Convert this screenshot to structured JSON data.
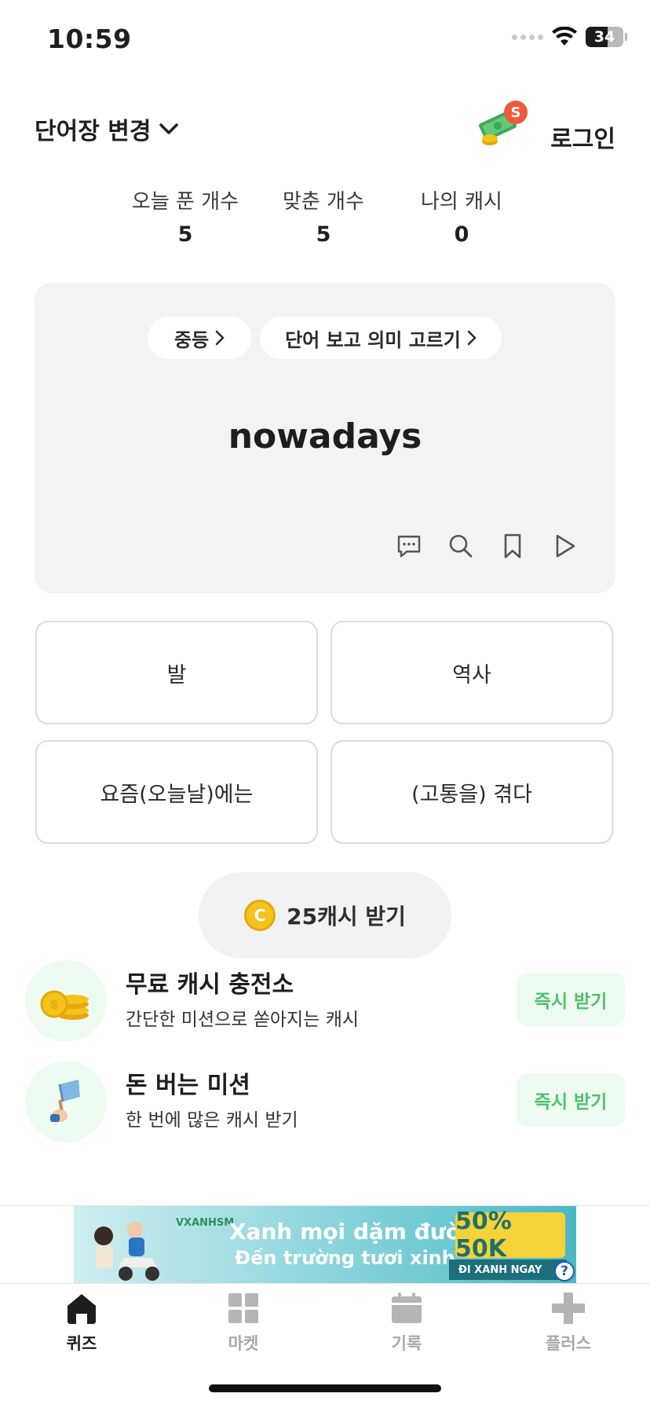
{
  "status_bar": {
    "time": "10:59",
    "battery": "34"
  },
  "header": {
    "wordbook_label": "단어장 변경",
    "login_label": "로그인",
    "badge": "S"
  },
  "stats": [
    {
      "label": "오늘 푼 개수",
      "value": "5"
    },
    {
      "label": "맞춘 개수",
      "value": "5"
    },
    {
      "label": "나의 캐시",
      "value": "0"
    }
  ],
  "quiz": {
    "level_chip": "중등",
    "mode_chip": "단어 보고 의미 고르기",
    "word": "nowadays",
    "icons": [
      "comment-icon",
      "search-icon",
      "bookmark-icon",
      "play-icon"
    ]
  },
  "answers": [
    "발",
    "역사",
    "요즘(오늘날)에는",
    "(고통을) 겪다"
  ],
  "cash_button": {
    "coin": "C",
    "label": "25캐시 받기"
  },
  "promos": [
    {
      "title": "무료 캐시 충전소",
      "subtitle": "간단한 미션으로 쏟아지는 캐시",
      "button": "즉시 받기",
      "icon": "coins-icon"
    },
    {
      "title": "돈 버는 미션",
      "subtitle": "한 번에 많은 캐시 받기",
      "button": "즉시 받기",
      "icon": "flag-hand-icon"
    }
  ],
  "ad": {
    "brand": "VXANHSM",
    "line1": "Xanh mọi dặm đường",
    "line2": "Đến trường tươi xinh",
    "offer": "50% 50K",
    "cta": "ĐI XANH NGAY",
    "help": "?"
  },
  "tabs": [
    {
      "label": "퀴즈",
      "icon": "home-icon",
      "active": true
    },
    {
      "label": "마켓",
      "icon": "grid-icon",
      "active": false
    },
    {
      "label": "기록",
      "icon": "calendar-icon",
      "active": false
    },
    {
      "label": "플러스",
      "icon": "plus-icon",
      "active": false
    }
  ],
  "colors": {
    "accent_green": "#4cc36a",
    "card_bg": "#f2f3f5",
    "badge_red": "#ec5a3b",
    "coin_yellow": "#f6c21c"
  }
}
